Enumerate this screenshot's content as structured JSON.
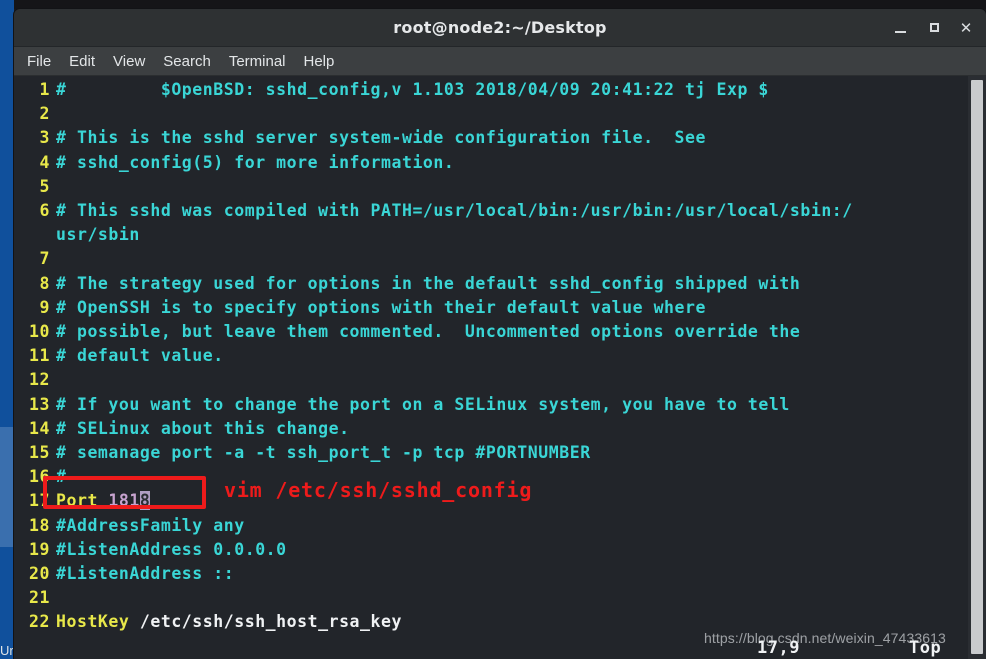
{
  "window": {
    "title": "root@node2:~/Desktop",
    "controls": {
      "minimize": "–",
      "maximize": "□",
      "close": "✕"
    }
  },
  "menubar": {
    "items": [
      {
        "label": "File"
      },
      {
        "label": "Edit"
      },
      {
        "label": "View"
      },
      {
        "label": "Search"
      },
      {
        "label": "Terminal"
      },
      {
        "label": "Help"
      }
    ]
  },
  "editor": {
    "filename": "/etc/ssh/sshd_config",
    "lines": [
      {
        "number": "1",
        "text": "#         $OpenBSD: sshd_config,v 1.103 2018/04/09 20:41:22 tj Exp $"
      },
      {
        "number": "2",
        "text": ""
      },
      {
        "number": "3",
        "text": "# This is the sshd server system-wide configuration file.  See"
      },
      {
        "number": "4",
        "text": "# sshd_config(5) for more information."
      },
      {
        "number": "5",
        "text": ""
      },
      {
        "number": "6",
        "text": "# This sshd was compiled with PATH=/usr/local/bin:/usr/bin:/usr/local/sbin:/usr/sbin"
      },
      {
        "number": "7",
        "text": ""
      },
      {
        "number": "8",
        "text": "# The strategy used for options in the default sshd_config shipped with"
      },
      {
        "number": "9",
        "text": "# OpenSSH is to specify options with their default value where"
      },
      {
        "number": "10",
        "text": "# possible, but leave them commented.  Uncommented options override the"
      },
      {
        "number": "11",
        "text": "# default value."
      },
      {
        "number": "12",
        "text": ""
      },
      {
        "number": "13",
        "text": "# If you want to change the port on a SELinux system, you have to tell"
      },
      {
        "number": "14",
        "text": "# SELinux about this change."
      },
      {
        "number": "15",
        "text": "# semanage port -a -t ssh_port_t -p tcp #PORTNUMBER"
      },
      {
        "number": "16",
        "text": "#"
      },
      {
        "number": "17",
        "text": "Port 1818"
      },
      {
        "number": "18",
        "text": "#AddressFamily any"
      },
      {
        "number": "19",
        "text": "#ListenAddress 0.0.0.0"
      },
      {
        "number": "20",
        "text": "#ListenAddress ::"
      },
      {
        "number": "21",
        "text": ""
      },
      {
        "number": "22",
        "text": "HostKey /etc/ssh/ssh_host_rsa_key"
      }
    ],
    "line6_wrap_continuation": "usr/sbin",
    "line6_first_part": "# This sshd was compiled with PATH=/usr/local/bin:/usr/bin:/usr/local/sbin:/",
    "port_line": {
      "keyword": "Port",
      "value_head": "181",
      "value_cursor": "8"
    },
    "status": {
      "position": "17,9",
      "scroll": "Top"
    }
  },
  "annotation": {
    "command": "vim /etc/ssh/sshd_config",
    "box_color": "#ee1b1b"
  },
  "desktop": {
    "bottom_left_label": "Ur",
    "strip_color": "#10509c"
  },
  "watermark": {
    "text": "https://blog.csdn.net/weixin_47433613"
  }
}
